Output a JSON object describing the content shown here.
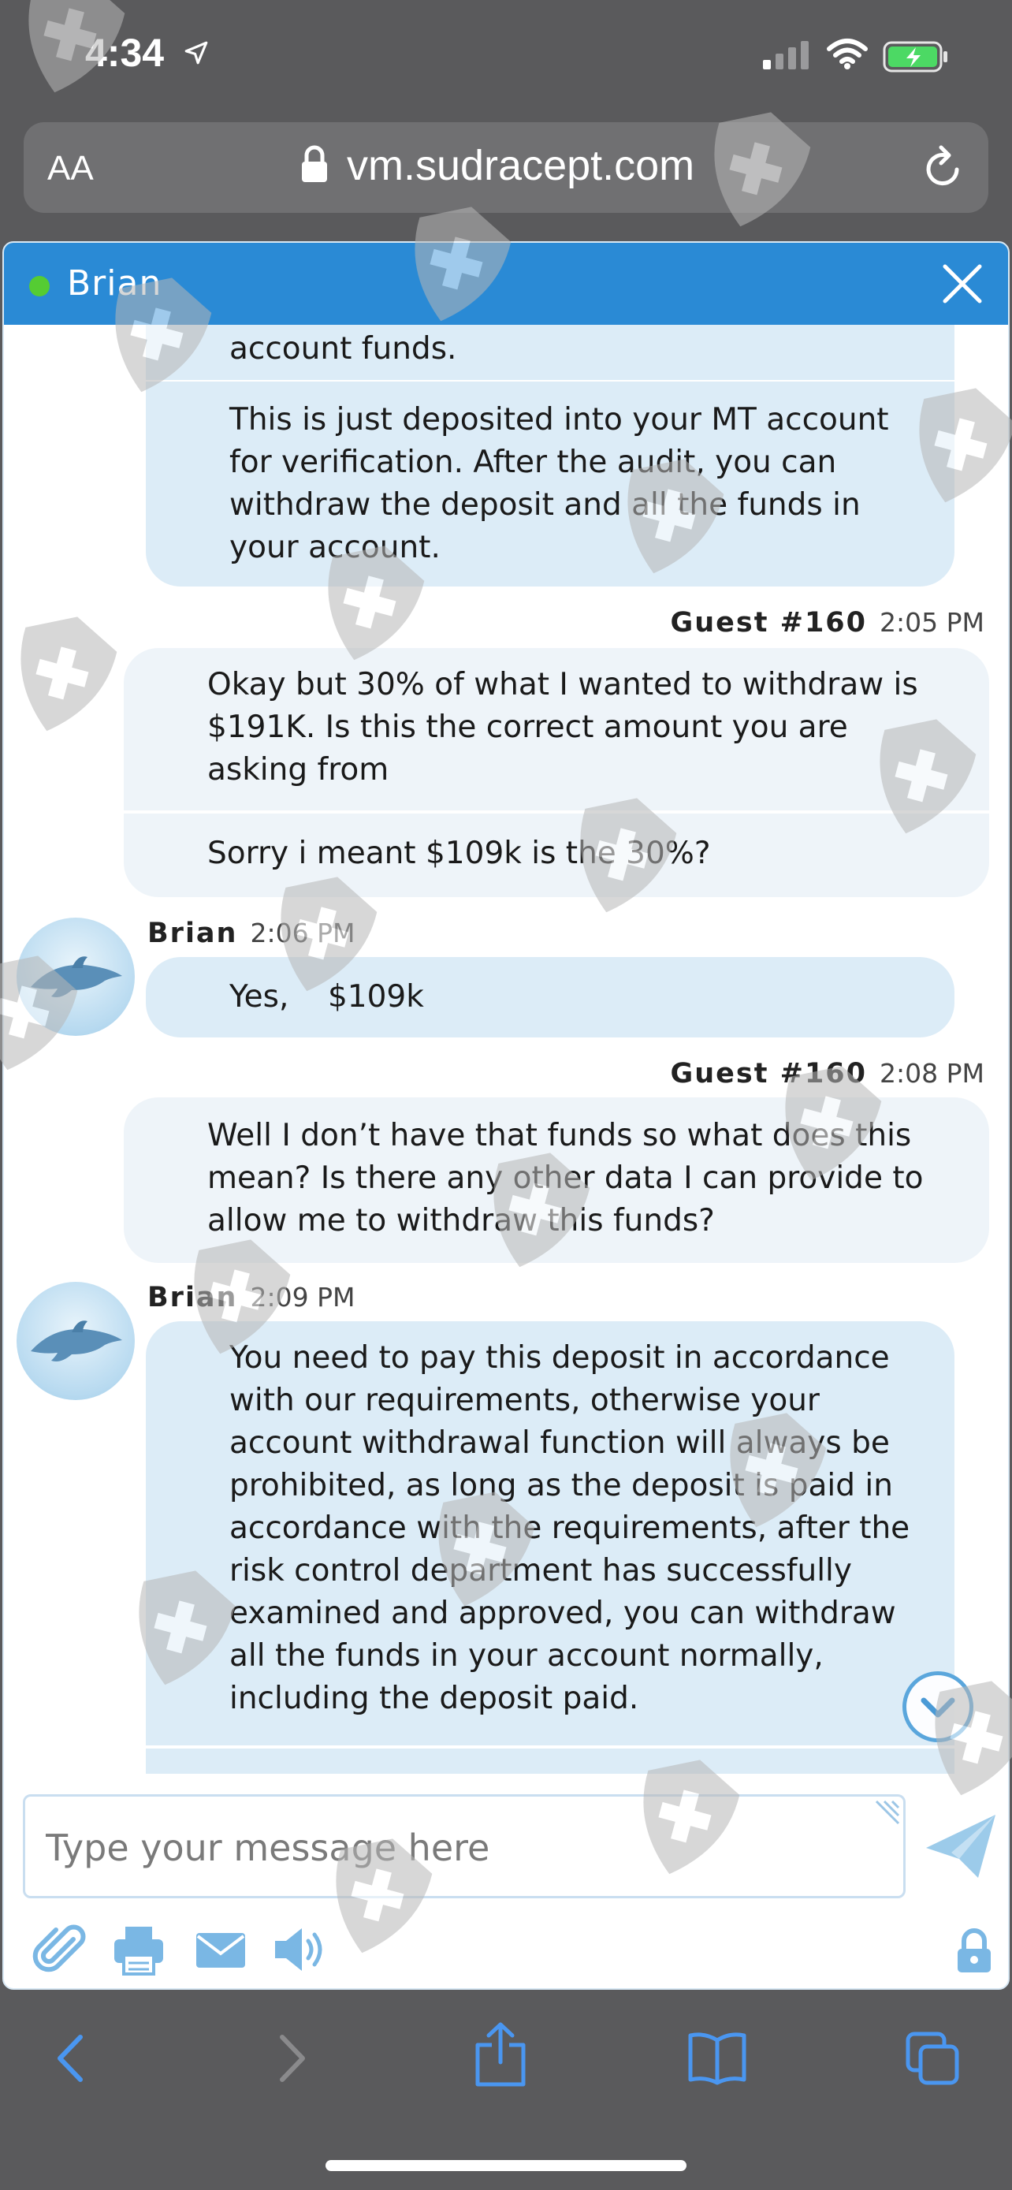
{
  "status_bar": {
    "time": "4:34"
  },
  "browser": {
    "aa_label": "AA",
    "url": "vm.sudracept.com"
  },
  "chat": {
    "agent_name": "Brian",
    "messages": [
      {
        "cut_text": "account funds.",
        "text": "This is just deposited into your MT account for verification. After the audit, you can withdraw the deposit and all the funds in your account."
      },
      {
        "sender": "Guest #160",
        "time": "2:05 PM",
        "text": "Okay but 30% of what I wanted to withdraw is $191K. Is this the correct amount you are asking from",
        "text2": "Sorry i meant $109k is the 30%?"
      },
      {
        "sender": "Brian",
        "time": "2:06 PM",
        "text": "Yes,    $109k"
      },
      {
        "sender": "Guest #160",
        "time": "2:08 PM",
        "text": "Well I don’t have that funds so what does this mean? Is there any other data I can provide to allow me to withdraw this funds?"
      },
      {
        "sender": "Brian",
        "time": "2:09 PM",
        "text": "You need to pay this deposit in accordance with our requirements, otherwise your account withdrawal function will always be prohibited, as long as the deposit is paid in accordance with the requirements, after the risk control department has successfully examined and approved, you can withdraw all the funds in your account normally, including the deposit paid."
      }
    ],
    "input_placeholder": "Type your message here"
  },
  "colors": {
    "header": "#2a8ad5",
    "agent_bubble": "#dcecf7",
    "guest_bubble": "#eef4f9",
    "online": "#55cc33"
  },
  "icons": [
    "location-arrow-icon",
    "signal-icon",
    "wifi-icon",
    "battery-charging-icon",
    "lock-icon",
    "reload-icon",
    "close-icon",
    "chevron-down-icon",
    "send-icon",
    "paperclip-icon",
    "printer-icon",
    "email-icon",
    "speaker-icon",
    "lock-icon",
    "back-icon",
    "forward-icon",
    "share-icon",
    "bookmarks-icon",
    "tabs-icon"
  ]
}
